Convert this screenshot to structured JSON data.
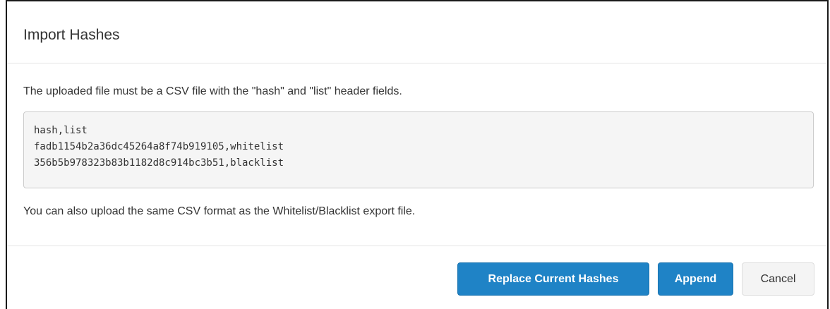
{
  "dialog": {
    "title": "Import Hashes",
    "intro": "The uploaded file must be a CSV file with the \"hash\" and \"list\" header fields.",
    "example_lines": [
      "hash,list",
      "fadb1154b2a36dc45264a8f74b919105,whitelist",
      "356b5b978323b83b1182d8c914bc3b51,blacklist"
    ],
    "note": "You can also upload the same CSV format as the Whitelist/Blacklist export file."
  },
  "footer": {
    "replace_label": "Replace Current Hashes",
    "append_label": "Append",
    "cancel_label": "Cancel"
  },
  "colors": {
    "primary": "#1f83c6",
    "default_button": "#f4f4f4",
    "code_background": "#f5f5f5"
  }
}
